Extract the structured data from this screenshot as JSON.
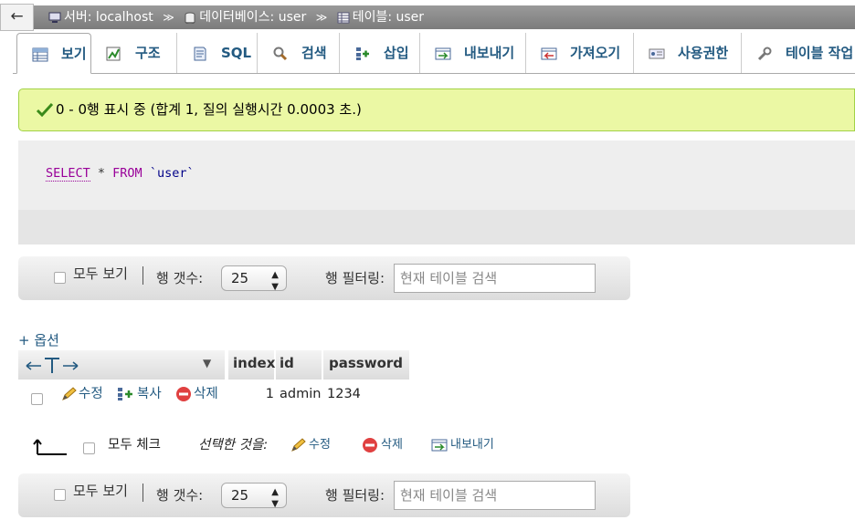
{
  "breadcrumb": {
    "back_label": "←",
    "server_label": "서버: localhost",
    "db_label": "데이터베이스: user",
    "table_label": "테이블: user",
    "separator": "≫"
  },
  "tabs": [
    {
      "label": "보기",
      "icon": "browse-icon",
      "active": true
    },
    {
      "label": "구조",
      "icon": "structure-icon"
    },
    {
      "label": "SQL",
      "icon": "sql-icon"
    },
    {
      "label": "검색",
      "icon": "search-icon"
    },
    {
      "label": "삽입",
      "icon": "insert-icon"
    },
    {
      "label": "내보내기",
      "icon": "export-icon"
    },
    {
      "label": "가져오기",
      "icon": "import-icon"
    },
    {
      "label": "사용권한",
      "icon": "privileges-icon"
    },
    {
      "label": "테이블 작업",
      "icon": "operations-icon"
    }
  ],
  "message": {
    "text": "0 - 0행 표시 중 (합계 1, 질의 실행시간 0.0003 초.)",
    "icon": "check-icon"
  },
  "sql": {
    "select": "SELECT",
    "star": " * ",
    "from": "FROM",
    "table": " `user`"
  },
  "nav": {
    "show_all": "모두 보기",
    "row_count_label": "행 갯수:",
    "row_count_value": "25",
    "filter_label": "행 필터링:",
    "filter_placeholder": "현재 테이블 검색"
  },
  "options_label": "+ 옵션",
  "table": {
    "columns": [
      "index",
      "id",
      "password"
    ],
    "rows": [
      {
        "index": "1",
        "id": "admin",
        "password": "1234",
        "edit": "수정",
        "copy": "복사",
        "delete": "삭제"
      }
    ]
  },
  "bulk": {
    "check_all": "모두 체크",
    "with_selected": "선택한 것을:",
    "edit": "수정",
    "delete": "삭제",
    "export": "내보내기"
  },
  "colors": {
    "link": "#235a81",
    "success_bg": "#ebf8a4",
    "breadcrumb_bg": "#8a8a8a"
  }
}
